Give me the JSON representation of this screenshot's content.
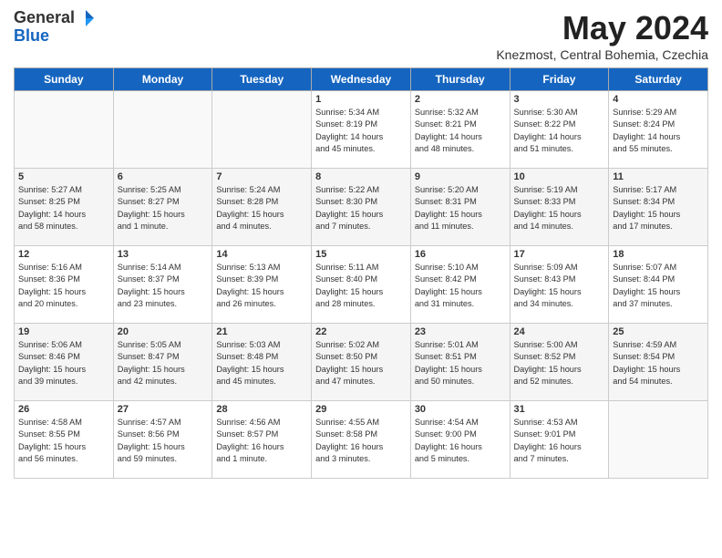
{
  "header": {
    "logo_general": "General",
    "logo_blue": "Blue",
    "month": "May 2024",
    "location": "Knezmost, Central Bohemia, Czechia"
  },
  "days_of_week": [
    "Sunday",
    "Monday",
    "Tuesday",
    "Wednesday",
    "Thursday",
    "Friday",
    "Saturday"
  ],
  "weeks": [
    [
      {
        "day": "",
        "info": ""
      },
      {
        "day": "",
        "info": ""
      },
      {
        "day": "",
        "info": ""
      },
      {
        "day": "1",
        "info": "Sunrise: 5:34 AM\nSunset: 8:19 PM\nDaylight: 14 hours\nand 45 minutes."
      },
      {
        "day": "2",
        "info": "Sunrise: 5:32 AM\nSunset: 8:21 PM\nDaylight: 14 hours\nand 48 minutes."
      },
      {
        "day": "3",
        "info": "Sunrise: 5:30 AM\nSunset: 8:22 PM\nDaylight: 14 hours\nand 51 minutes."
      },
      {
        "day": "4",
        "info": "Sunrise: 5:29 AM\nSunset: 8:24 PM\nDaylight: 14 hours\nand 55 minutes."
      }
    ],
    [
      {
        "day": "5",
        "info": "Sunrise: 5:27 AM\nSunset: 8:25 PM\nDaylight: 14 hours\nand 58 minutes."
      },
      {
        "day": "6",
        "info": "Sunrise: 5:25 AM\nSunset: 8:27 PM\nDaylight: 15 hours\nand 1 minute."
      },
      {
        "day": "7",
        "info": "Sunrise: 5:24 AM\nSunset: 8:28 PM\nDaylight: 15 hours\nand 4 minutes."
      },
      {
        "day": "8",
        "info": "Sunrise: 5:22 AM\nSunset: 8:30 PM\nDaylight: 15 hours\nand 7 minutes."
      },
      {
        "day": "9",
        "info": "Sunrise: 5:20 AM\nSunset: 8:31 PM\nDaylight: 15 hours\nand 11 minutes."
      },
      {
        "day": "10",
        "info": "Sunrise: 5:19 AM\nSunset: 8:33 PM\nDaylight: 15 hours\nand 14 minutes."
      },
      {
        "day": "11",
        "info": "Sunrise: 5:17 AM\nSunset: 8:34 PM\nDaylight: 15 hours\nand 17 minutes."
      }
    ],
    [
      {
        "day": "12",
        "info": "Sunrise: 5:16 AM\nSunset: 8:36 PM\nDaylight: 15 hours\nand 20 minutes."
      },
      {
        "day": "13",
        "info": "Sunrise: 5:14 AM\nSunset: 8:37 PM\nDaylight: 15 hours\nand 23 minutes."
      },
      {
        "day": "14",
        "info": "Sunrise: 5:13 AM\nSunset: 8:39 PM\nDaylight: 15 hours\nand 26 minutes."
      },
      {
        "day": "15",
        "info": "Sunrise: 5:11 AM\nSunset: 8:40 PM\nDaylight: 15 hours\nand 28 minutes."
      },
      {
        "day": "16",
        "info": "Sunrise: 5:10 AM\nSunset: 8:42 PM\nDaylight: 15 hours\nand 31 minutes."
      },
      {
        "day": "17",
        "info": "Sunrise: 5:09 AM\nSunset: 8:43 PM\nDaylight: 15 hours\nand 34 minutes."
      },
      {
        "day": "18",
        "info": "Sunrise: 5:07 AM\nSunset: 8:44 PM\nDaylight: 15 hours\nand 37 minutes."
      }
    ],
    [
      {
        "day": "19",
        "info": "Sunrise: 5:06 AM\nSunset: 8:46 PM\nDaylight: 15 hours\nand 39 minutes."
      },
      {
        "day": "20",
        "info": "Sunrise: 5:05 AM\nSunset: 8:47 PM\nDaylight: 15 hours\nand 42 minutes."
      },
      {
        "day": "21",
        "info": "Sunrise: 5:03 AM\nSunset: 8:48 PM\nDaylight: 15 hours\nand 45 minutes."
      },
      {
        "day": "22",
        "info": "Sunrise: 5:02 AM\nSunset: 8:50 PM\nDaylight: 15 hours\nand 47 minutes."
      },
      {
        "day": "23",
        "info": "Sunrise: 5:01 AM\nSunset: 8:51 PM\nDaylight: 15 hours\nand 50 minutes."
      },
      {
        "day": "24",
        "info": "Sunrise: 5:00 AM\nSunset: 8:52 PM\nDaylight: 15 hours\nand 52 minutes."
      },
      {
        "day": "25",
        "info": "Sunrise: 4:59 AM\nSunset: 8:54 PM\nDaylight: 15 hours\nand 54 minutes."
      }
    ],
    [
      {
        "day": "26",
        "info": "Sunrise: 4:58 AM\nSunset: 8:55 PM\nDaylight: 15 hours\nand 56 minutes."
      },
      {
        "day": "27",
        "info": "Sunrise: 4:57 AM\nSunset: 8:56 PM\nDaylight: 15 hours\nand 59 minutes."
      },
      {
        "day": "28",
        "info": "Sunrise: 4:56 AM\nSunset: 8:57 PM\nDaylight: 16 hours\nand 1 minute."
      },
      {
        "day": "29",
        "info": "Sunrise: 4:55 AM\nSunset: 8:58 PM\nDaylight: 16 hours\nand 3 minutes."
      },
      {
        "day": "30",
        "info": "Sunrise: 4:54 AM\nSunset: 9:00 PM\nDaylight: 16 hours\nand 5 minutes."
      },
      {
        "day": "31",
        "info": "Sunrise: 4:53 AM\nSunset: 9:01 PM\nDaylight: 16 hours\nand 7 minutes."
      },
      {
        "day": "",
        "info": ""
      }
    ]
  ]
}
